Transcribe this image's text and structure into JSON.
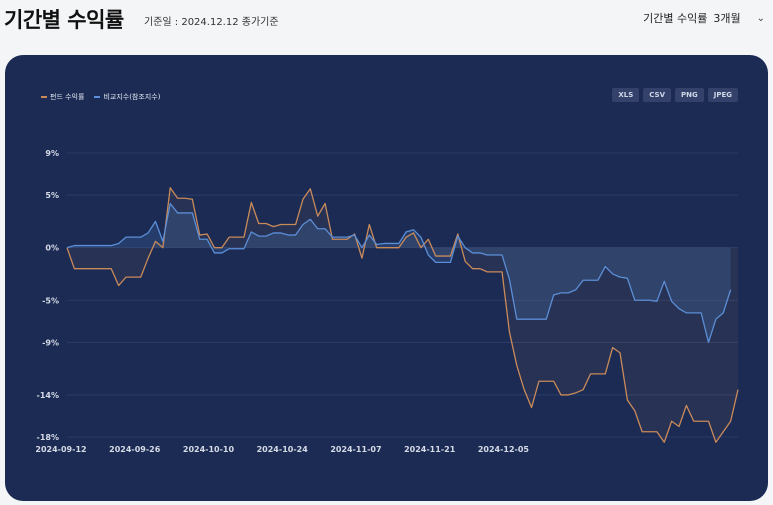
{
  "header": {
    "title": "기간별 수익률",
    "subtitle": "기준일 : 2024.12.12 종가기준",
    "period_label": "기간별 수익률",
    "period_value": "3개월",
    "chevron_icon": "chevron-down-icon"
  },
  "exports": [
    "XLS",
    "CSV",
    "PNG",
    "JPEG"
  ],
  "chart_data": {
    "type": "line",
    "ylim": [
      -18,
      9
    ],
    "yticks": [
      9,
      5,
      0,
      -5,
      -9,
      -14,
      -18
    ],
    "ytick_labels": [
      "9%",
      "5%",
      "0%",
      "-5%",
      "-9%",
      "-14%",
      "-18%"
    ],
    "xtick_labels": [
      "2024-09-12",
      "2024-09-26",
      "2024-10-10",
      "2024-10-24",
      "2024-11-07",
      "2024-11-21",
      "2024-12-05"
    ],
    "grid": true,
    "legend_position": "top-left",
    "series": [
      {
        "name": "펀드 수익률",
        "color": "#c98a5a",
        "values": [
          0,
          -2,
          -2,
          -2,
          -2,
          -2,
          -2,
          -3.6,
          -2.8,
          -2.8,
          -2.8,
          -1,
          0.6,
          0,
          5.7,
          4.7,
          4.7,
          4.6,
          1.2,
          1.3,
          0,
          0,
          1,
          1,
          1,
          4.3,
          2.3,
          2.3,
          2,
          2.2,
          2.2,
          2.2,
          4.6,
          5.6,
          3,
          4.2,
          0.8,
          0.8,
          0.8,
          1.3,
          -1,
          2.2,
          0,
          0,
          0,
          0,
          1,
          1.4,
          0,
          0.8,
          -0.8,
          -0.8,
          -0.8,
          1.3,
          -1.3,
          -2,
          -2,
          -2.3,
          -2.3,
          -2.3,
          -8,
          -11.2,
          -13.5,
          -15.2,
          -12.7,
          -12.7,
          -12.7,
          -14,
          -14,
          -13.8,
          -13.5,
          -12,
          -12,
          -12,
          -9.5,
          -10,
          -14.5,
          -15.5,
          -17.5,
          -17.5,
          -17.5,
          -18.5,
          -16.5,
          -17,
          -15,
          -16.5,
          -16.5,
          -16.5,
          -18.5,
          -17.5,
          -16.5,
          -13.5
        ]
      },
      {
        "name": "비교지수(참조지수)",
        "color": "#5b8ed6",
        "values": [
          0,
          0.2,
          0.2,
          0.2,
          0.2,
          0.2,
          0.2,
          0.4,
          1,
          1,
          1,
          1.4,
          2.5,
          0.6,
          4.2,
          3.3,
          3.3,
          3.3,
          0.8,
          0.8,
          -0.5,
          -0.5,
          -0.1,
          -0.1,
          -0.1,
          1.5,
          1.1,
          1.1,
          1.4,
          1.4,
          1.2,
          1.2,
          2.2,
          2.7,
          1.8,
          1.8,
          1,
          1,
          1,
          1.2,
          0,
          1.2,
          0.3,
          0.4,
          0.4,
          0.4,
          1.5,
          1.7,
          1,
          -0.7,
          -1.4,
          -1.4,
          -1.4,
          1.1,
          0,
          -0.5,
          -0.5,
          -0.7,
          -0.7,
          -0.7,
          -3,
          -6.8,
          -6.8,
          -6.8,
          -6.8,
          -6.8,
          -4.5,
          -4.3,
          -4.3,
          -4,
          -3.1,
          -3.1,
          -3.1,
          -1.8,
          -2.5,
          -2.8,
          -2.9,
          -5,
          -5,
          -5,
          -5.1,
          -3.2,
          -5.1,
          -5.8,
          -6.2,
          -6.2,
          -6.2,
          -9,
          -6.8,
          -6.2,
          -4
        ]
      }
    ]
  }
}
